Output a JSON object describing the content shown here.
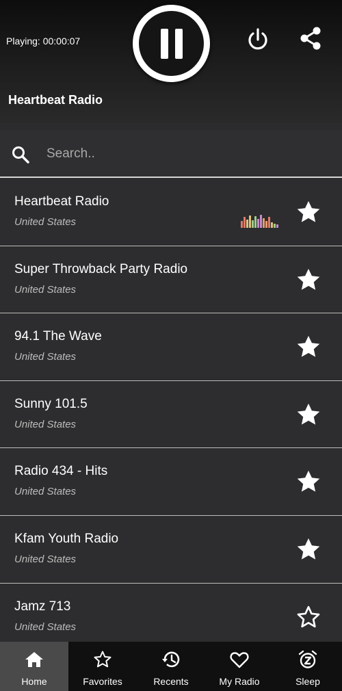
{
  "player": {
    "playing_text": "Playing: 00:00:07",
    "current_station": "Heartbeat Radio",
    "state": "playing"
  },
  "search": {
    "placeholder": "Search.."
  },
  "stations": [
    {
      "name": "Heartbeat Radio",
      "country": "United States",
      "favorite": true,
      "now_playing": true
    },
    {
      "name": "Super Throwback Party Radio",
      "country": "United States",
      "favorite": true,
      "now_playing": false
    },
    {
      "name": "94.1 The Wave",
      "country": "United States",
      "favorite": true,
      "now_playing": false
    },
    {
      "name": "Sunny 101.5",
      "country": "United States",
      "favorite": true,
      "now_playing": false
    },
    {
      "name": "Radio 434 - Hits",
      "country": "United States",
      "favorite": true,
      "now_playing": false
    },
    {
      "name": "Kfam Youth Radio",
      "country": "United States",
      "favorite": true,
      "now_playing": false
    },
    {
      "name": "Jamz 713",
      "country": "United States",
      "favorite": false,
      "now_playing": false
    }
  ],
  "nav": [
    {
      "label": "Home",
      "icon": "home-icon",
      "active": true
    },
    {
      "label": "Favorites",
      "icon": "star-outline-icon",
      "active": false
    },
    {
      "label": "Recents",
      "icon": "history-icon",
      "active": false
    },
    {
      "label": "My Radio",
      "icon": "heart-outline-icon",
      "active": false
    },
    {
      "label": "Sleep",
      "icon": "alarm-sleep-icon",
      "active": false
    }
  ],
  "colors": {
    "background": "#2c2c2e",
    "header_top": "#0d0d0d",
    "nav_background": "#101010",
    "nav_active": "#4a4a4a",
    "divider": "#bdbdbd",
    "subtitle": "#bdbdbd",
    "eq_bars": [
      "#e07a6a",
      "#e3c27a",
      "#9fcf8a",
      "#c98ad0",
      "#e39d6d"
    ]
  }
}
